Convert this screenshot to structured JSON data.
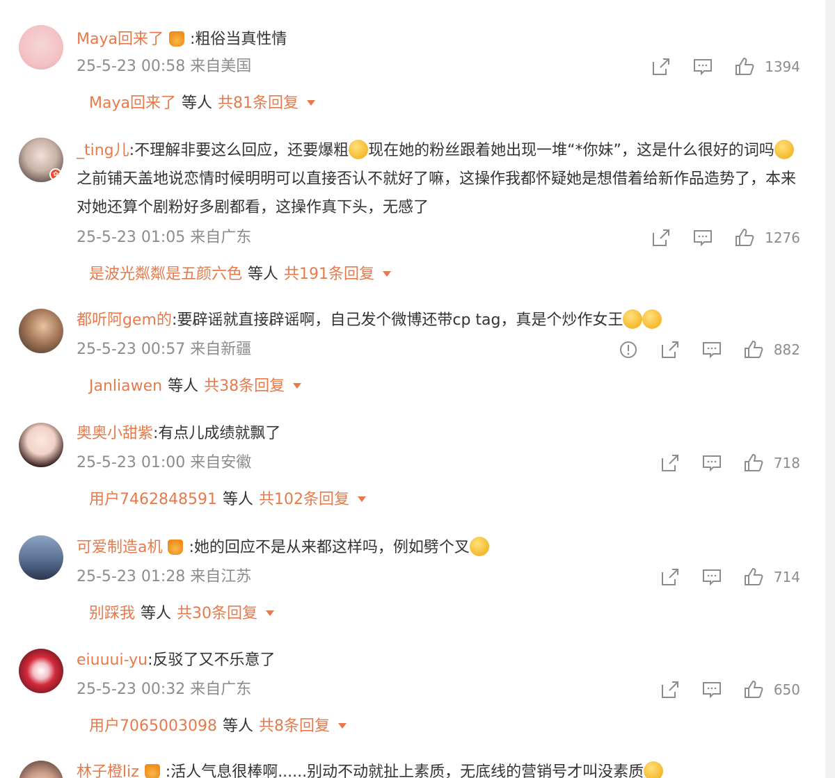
{
  "comments": [
    {
      "username": "Maya回来了",
      "vip": true,
      "text": ":粗俗当真性情",
      "date": "25-5-23 00:58",
      "location": "来自美国",
      "likes": "1394",
      "reply_user": "Maya回来了",
      "reply_others": "等人",
      "reply_count": "共81条回复"
    },
    {
      "username": "_ting儿",
      "vip": false,
      "text": ":不理解非要这么回应，还要爆粗[emoji]现在她的粉丝跟着她出现一堆“*你妹”，这是什么很好的词吗[emoji]之前铺天盖地说恋情时候明明可以直接否认不就好了嘛，这操作我都怀疑她是想借着给新作品造势了，本来对她还算个剧粉好多剧都看，这操作真下头，无感了",
      "text_part1": ":不理解非要这么回应，还要爆粗",
      "text_part2": "现在她的粉丝跟着她出现一堆“*你妹”，这是什么很好的词吗",
      "text_part3": "之前铺天盖地说恋情时候明明可以直接否认不就好了嘛，这操作我都怀疑她是想借着给新作品造势了，本来对她还算个剧粉好多剧都看，这操作真下头，无感了",
      "date": "25-5-23 01:05",
      "location": "来自广东",
      "likes": "1276",
      "reply_user": "是波光粼粼是五颜六色",
      "reply_others": "等人",
      "reply_count": "共191条回复"
    },
    {
      "username": "都听阿gem的",
      "vip": false,
      "text": ":要辟谣就直接辟谣啊，自己发个微博还带cp tag，真是个炒作女王",
      "date": "25-5-23 00:57",
      "location": "来自新疆",
      "likes": "882",
      "reply_user": "Janliawen",
      "reply_others": "等人",
      "reply_count": "共38条回复"
    },
    {
      "username": "奥奥小甜紫",
      "vip": false,
      "text": ":有点儿成绩就飘了",
      "date": "25-5-23 01:00",
      "location": "来自安徽",
      "likes": "718",
      "reply_user": "用户7462848591",
      "reply_others": "等人",
      "reply_count": "共102条回复"
    },
    {
      "username": "可爱制造a机",
      "vip": true,
      "text": ":她的回应不是从来都这样吗，例如劈个叉",
      "date": "25-5-23 01:28",
      "location": "来自江苏",
      "likes": "714",
      "reply_user": "别踩我",
      "reply_others": "等人",
      "reply_count": "共30条回复"
    },
    {
      "username": "eiuuui-yu",
      "vip": false,
      "text": ":反驳了又不乐意了",
      "date": "25-5-23 00:32",
      "location": "来自广东",
      "likes": "650",
      "reply_user": "用户7065003098",
      "reply_others": "等人",
      "reply_count": "共8条回复"
    },
    {
      "username": "林子橙liz",
      "vip": true,
      "text": ":活人气息很棒啊......别动不动就扯上素质，无底线的营销号才叫没素质",
      "date": "",
      "location": "",
      "likes": "",
      "reply_user": "",
      "reply_others": "",
      "reply_count": ""
    }
  ],
  "colors": {
    "username": "#e8794a",
    "meta": "#8c8c8c",
    "text": "#333333"
  },
  "icons": {
    "share": "share-icon",
    "comment": "comment-icon",
    "like": "thumbs-up-icon",
    "report": "report-icon"
  }
}
